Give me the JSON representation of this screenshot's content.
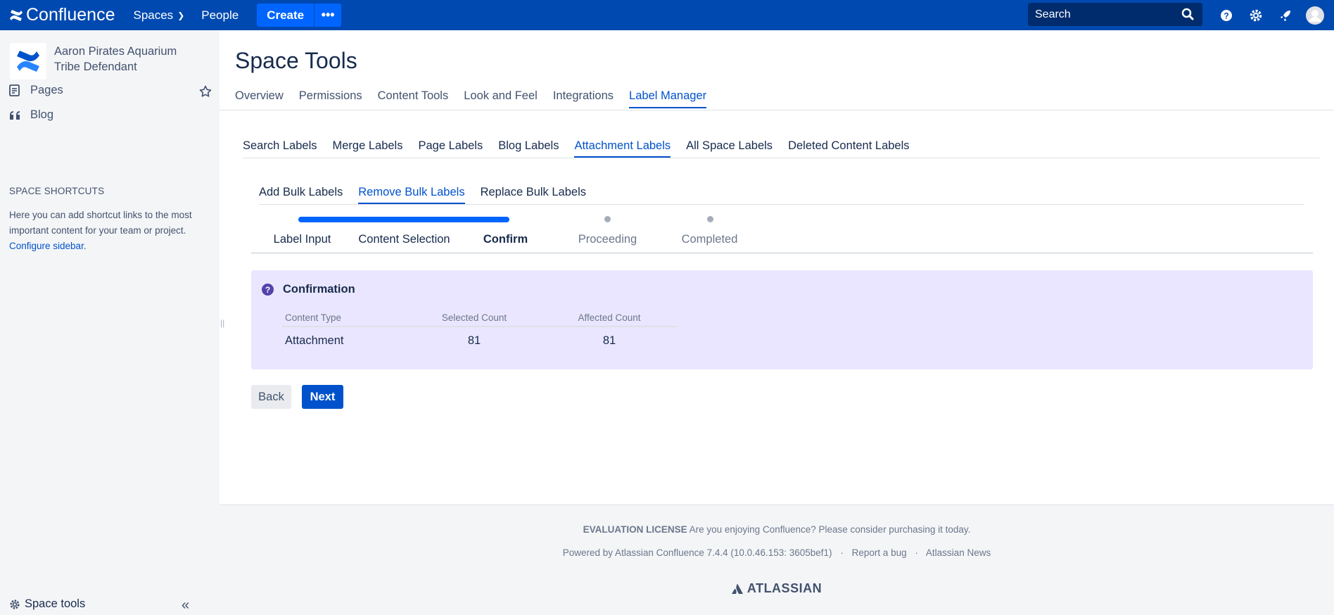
{
  "topnav": {
    "brand": "Confluence",
    "spaces": "Spaces",
    "people": "People",
    "create": "Create",
    "more": "•••",
    "search_placeholder": "Search"
  },
  "sidebar": {
    "space_name": "Aaron Pirates Aquarium Tribe Defendant",
    "items": [
      {
        "label": "Pages",
        "icon": "pages-icon"
      },
      {
        "label": "Blog",
        "icon": "blog-icon"
      }
    ],
    "shortcuts_title": "SPACE SHORTCUTS",
    "shortcuts_text": "Here you can add shortcut links to the most important content for your team or project. ",
    "configure_link": "Configure sidebar",
    "configure_suffix": ".",
    "space_tools": "Space tools"
  },
  "page": {
    "title": "Space Tools",
    "tabs": [
      "Overview",
      "Permissions",
      "Content Tools",
      "Look and Feel",
      "Integrations",
      "Label Manager"
    ],
    "subtabs": [
      "Search Labels",
      "Merge Labels",
      "Page Labels",
      "Blog Labels",
      "Attachment Labels",
      "All Space Labels",
      "Deleted Content Labels"
    ],
    "bulk_tabs": [
      "Add Bulk Labels",
      "Remove Bulk Labels",
      "Replace Bulk Labels"
    ],
    "steps": [
      "Label Input",
      "Content Selection",
      "Confirm",
      "Proceeding",
      "Completed"
    ],
    "steps_completed_fraction": 0.6
  },
  "confirmation": {
    "title": "Confirmation",
    "headers": [
      "Content Type",
      "Selected Count",
      "Affected Count"
    ],
    "rows": [
      {
        "type": "Attachment",
        "selected": "81",
        "affected": "81"
      }
    ]
  },
  "buttons": {
    "back": "Back",
    "next": "Next"
  },
  "footer": {
    "license_bold": "EVALUATION LICENSE",
    "license_text": " Are you enjoying Confluence? Please consider purchasing it today.",
    "powered": "Powered by Atlassian Confluence 7.4.4 (10.0.46.153: 3605bef1)",
    "report": "Report a bug",
    "news": "Atlassian News",
    "sep": "·",
    "brand": "ATLASSIAN"
  },
  "colors": {
    "nav": "#0049b0",
    "accent": "#0052cc",
    "confirm_bg": "#eae6ff"
  }
}
